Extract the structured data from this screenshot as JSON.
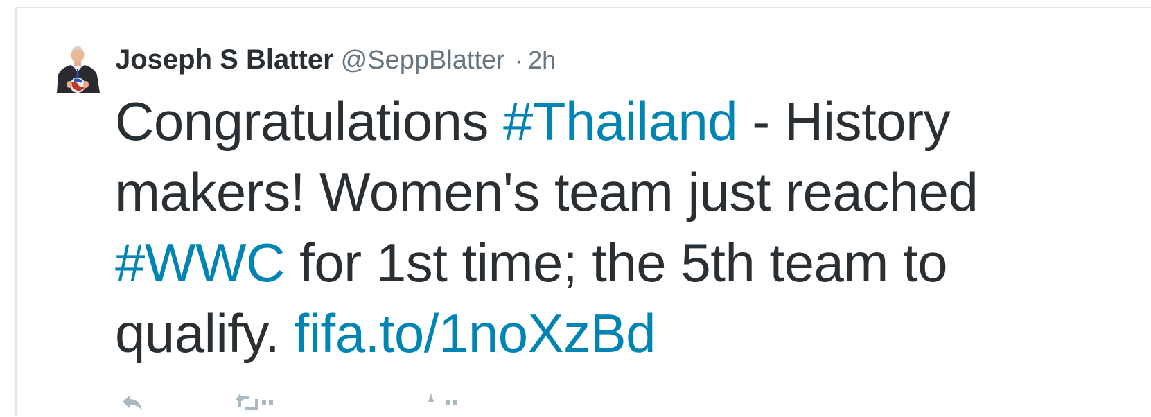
{
  "tweet": {
    "display_name": "Joseph S Blatter",
    "handle": "@SeppBlatter",
    "separator": "·",
    "time": "2h",
    "text": {
      "part1": "Congratulations ",
      "hashtag1": "#Thailand",
      "part2": " - History makers! Women's team just reached ",
      "hashtag2": "#WWC",
      "part3": " for 1st time; the 5th team to qualify. ",
      "link": "fifa.to/1noXzBd"
    },
    "colors": {
      "text": "#292f33",
      "secondary": "#66757f",
      "link": "#0084b4",
      "border": "#e1e8ed"
    },
    "actions": {
      "reply_icon": "reply-icon",
      "retweet_icon": "retweet-icon",
      "favorite_icon": "favorite-icon"
    }
  }
}
